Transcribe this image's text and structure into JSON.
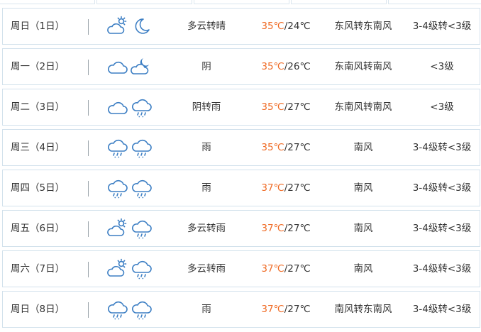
{
  "forecast": [
    {
      "day": "周日（1日）",
      "icons": [
        "partly-cloudy-day-icon",
        "moon-icon"
      ],
      "condition": "多云转晴",
      "high": "35℃",
      "low": "/24℃",
      "wind_direction": "东风转东南风",
      "wind_level": "3-4级转<3级"
    },
    {
      "day": "周一（2日）",
      "icons": [
        "cloud-icon",
        "partly-cloudy-night-icon"
      ],
      "condition": "阴",
      "high": "35℃",
      "low": "/26℃",
      "wind_direction": "东南风转南风",
      "wind_level": "<3级"
    },
    {
      "day": "周二（3日）",
      "icons": [
        "cloud-icon",
        "rain-icon"
      ],
      "condition": "阴转雨",
      "high": "35℃",
      "low": "/27℃",
      "wind_direction": "东南风转南风",
      "wind_level": "<3级"
    },
    {
      "day": "周三（4日）",
      "icons": [
        "rain-icon",
        "rain-icon"
      ],
      "condition": "雨",
      "high": "35℃",
      "low": "/27℃",
      "wind_direction": "南风",
      "wind_level": "3-4级转<3级"
    },
    {
      "day": "周四（5日）",
      "icons": [
        "rain-icon",
        "rain-icon"
      ],
      "condition": "雨",
      "high": "37℃",
      "low": "/27℃",
      "wind_direction": "南风",
      "wind_level": "3-4级转<3级"
    },
    {
      "day": "周五（6日）",
      "icons": [
        "partly-cloudy-day-icon",
        "rain-icon"
      ],
      "condition": "多云转雨",
      "high": "37℃",
      "low": "/27℃",
      "wind_direction": "南风",
      "wind_level": "3-4级转<3级"
    },
    {
      "day": "周六（7日）",
      "icons": [
        "partly-cloudy-day-icon",
        "rain-icon"
      ],
      "condition": "多云转雨",
      "high": "37℃",
      "low": "/27℃",
      "wind_direction": "南风",
      "wind_level": "3-4级转<3级"
    },
    {
      "day": "周日（8日）",
      "icons": [
        "rain-icon",
        "rain-icon"
      ],
      "condition": "雨",
      "high": "37℃",
      "low": "/27℃",
      "wind_direction": "南风转东南风",
      "wind_level": "3-4级转<3级"
    }
  ],
  "colors": {
    "high_temp": "#ef6a24",
    "icon_stroke": "#3d7fc4",
    "row_border": "#d2e1ec"
  }
}
